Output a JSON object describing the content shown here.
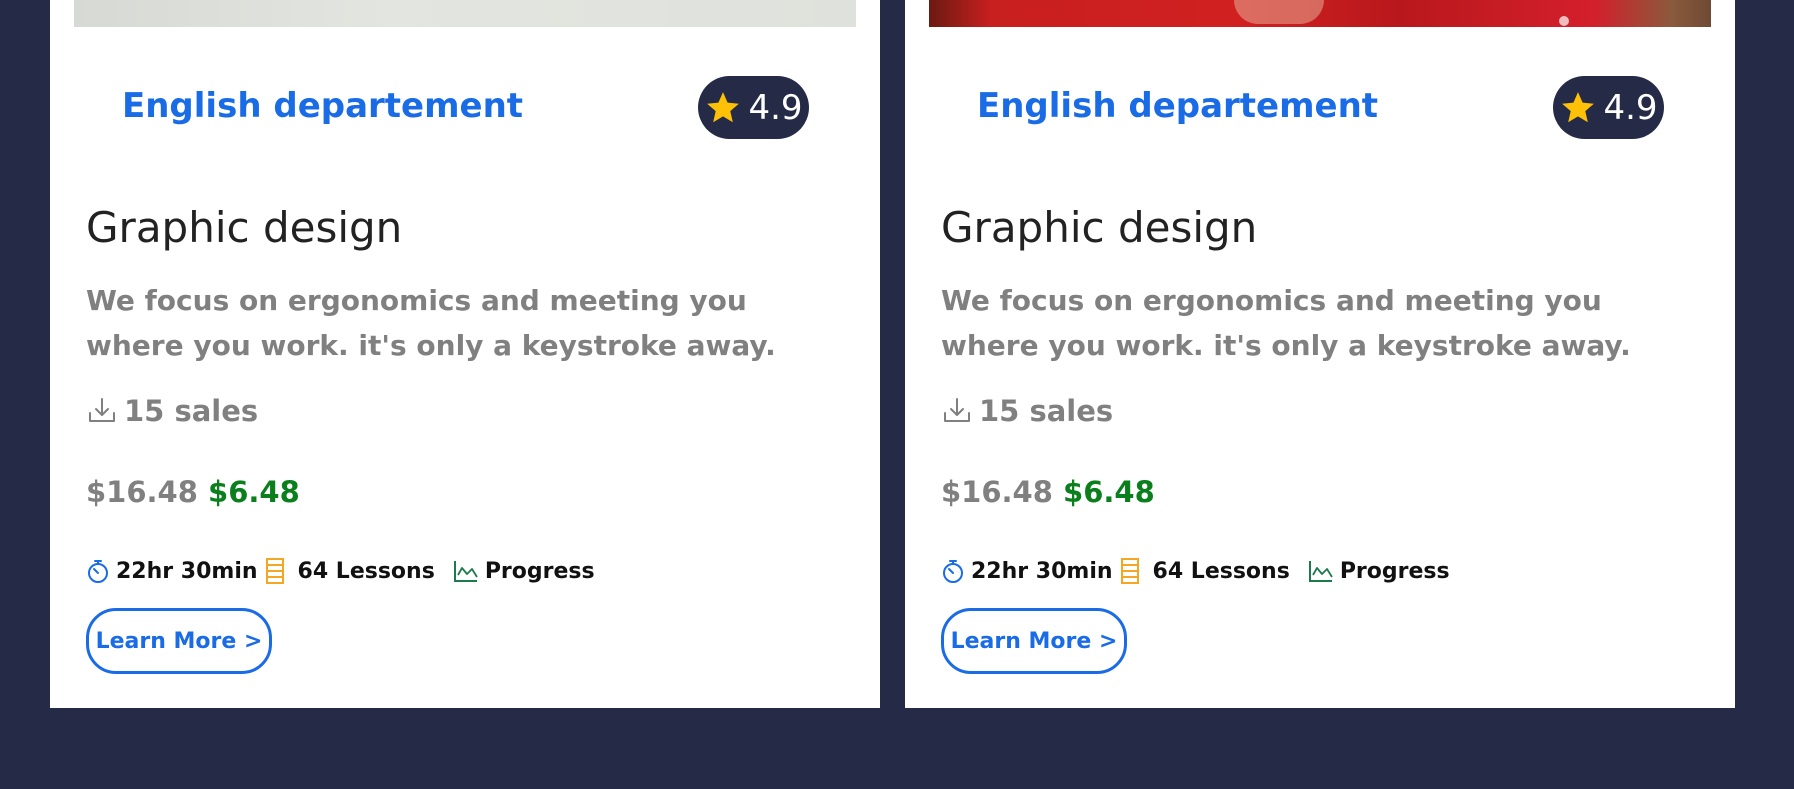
{
  "cards": [
    {
      "department": "English departement",
      "rating": "4.9",
      "title": "Graphic design",
      "description": "We focus on ergonomics and meeting you where you work. it's only a keystroke away.",
      "sales": "15 sales",
      "old_price": "$16.48",
      "new_price": "$6.48",
      "duration": "22hr 30min",
      "lessons": "64 Lessons",
      "progress": "Progress",
      "button_label": "Learn More >"
    },
    {
      "department": "English departement",
      "rating": "4.9",
      "title": "Graphic design",
      "description": "We focus on ergonomics and meeting you where you work. it's only a keystroke away.",
      "sales": "15 sales",
      "old_price": "$16.48",
      "new_price": "$6.48",
      "duration": "22hr 30min",
      "lessons": "64 Lessons",
      "progress": "Progress",
      "button_label": "Learn More >"
    }
  ],
  "colors": {
    "page_background": "#252b47",
    "accent_blue": "#1a6be6",
    "sale_green": "#0a7f1c",
    "muted_gray": "#808080",
    "star_yellow": "#ffc107",
    "lessons_orange": "#f5a623",
    "progress_green": "#1d7a4c"
  },
  "icons": {
    "rating": "star-icon",
    "sales": "download-icon",
    "duration": "stopwatch-icon",
    "lessons": "list-icon",
    "progress": "line-chart-icon"
  }
}
